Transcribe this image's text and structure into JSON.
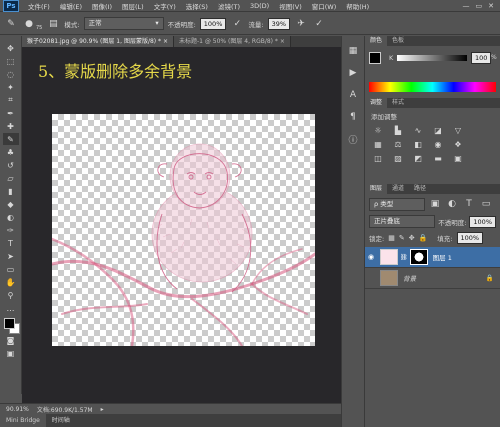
{
  "app": {
    "logo": "Ps"
  },
  "menu": [
    "文件(F)",
    "编辑(E)",
    "图像(I)",
    "图层(L)",
    "文字(Y)",
    "选择(S)",
    "滤镜(T)",
    "3D(D)",
    "视图(V)",
    "窗口(W)",
    "帮助(H)"
  ],
  "window_buttons": {
    "minimize": "—",
    "restore": "▭",
    "close": "✕"
  },
  "options": {
    "mode_label": "模式:",
    "mode_value": "正常",
    "opacity_label": "不透明度:",
    "opacity_value": "100%",
    "flow_label": "流量:",
    "flow_value": "39%",
    "brush_size": "75"
  },
  "tabs": [
    {
      "label": "猴子02081.jpg @ 90.9% (图层 1, 图层蒙版/8) *",
      "close": "×"
    },
    {
      "label": "未标题-1 @ 50% (图层 4, RGB/8) *",
      "close": "×"
    }
  ],
  "canvas": {
    "title_text": "5、蒙版删除多余背景"
  },
  "status": {
    "zoom": "90.91%",
    "doc_info": "文档:690.9K/1.57M"
  },
  "bottom_tabs": [
    "Mini Bridge",
    "时间轴"
  ],
  "color_panel": {
    "tabs": [
      "颜色",
      "色板"
    ],
    "channel_label": "K",
    "value": "100",
    "unit": "%"
  },
  "adjust_panel": {
    "tabs": [
      "调整",
      "样式"
    ],
    "heading": "添加调整"
  },
  "layers_panel": {
    "tabs": [
      "图层",
      "通道",
      "路径"
    ],
    "filter_label": "ρ 类型",
    "blend_mode": "正片叠底",
    "opacity_label": "不透明度:",
    "opacity_value": "100%",
    "lock_label": "锁定:",
    "fill_label": "填充:",
    "fill_value": "100%",
    "layers": [
      {
        "name": "图层 1",
        "selected": true
      },
      {
        "name": "背景",
        "selected": false
      }
    ]
  }
}
